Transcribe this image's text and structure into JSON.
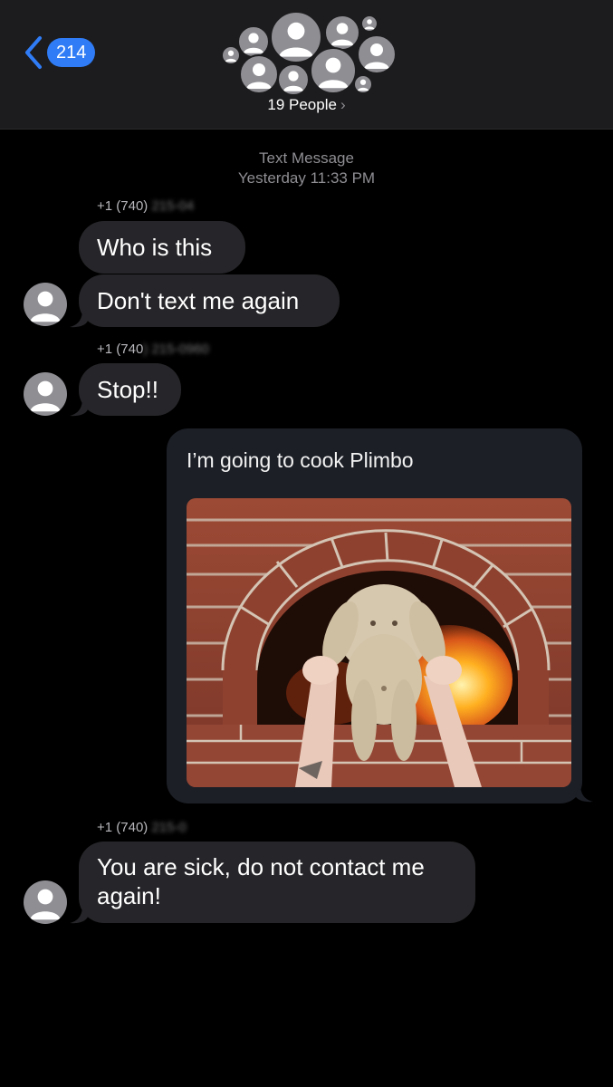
{
  "header": {
    "back_count": "214",
    "people_label": "19 People",
    "people_chevron": "›"
  },
  "thread": {
    "service_label": "Text Message",
    "timestamp": "Yesterday 11:33 PM"
  },
  "messages": [
    {
      "sender_prefix": "+1 (740)",
      "sender_obscured": "215-04",
      "text": "Who is this"
    },
    {
      "text": "Don't text me again"
    },
    {
      "sender_prefix": "+1 (740",
      "sender_obscured": ") 215-0960",
      "text": "Stop!!"
    },
    {
      "sent_text": "I’m going to cook Plimbo"
    },
    {
      "sender_prefix": "+1 (740)",
      "sender_obscured": "215-0",
      "text_line1": "You are sick, do not contact me",
      "text_line2": "again!"
    }
  ],
  "colors": {
    "background": "#000000",
    "header": "#1c1c1e",
    "received_bubble": "#26262a",
    "sent_card": "#1c1f26",
    "accent": "#2f7cf6",
    "avatar": "#8e8e93"
  },
  "icons": {
    "back": "chevron-left-icon",
    "contact": "person-silhouette-icon"
  }
}
